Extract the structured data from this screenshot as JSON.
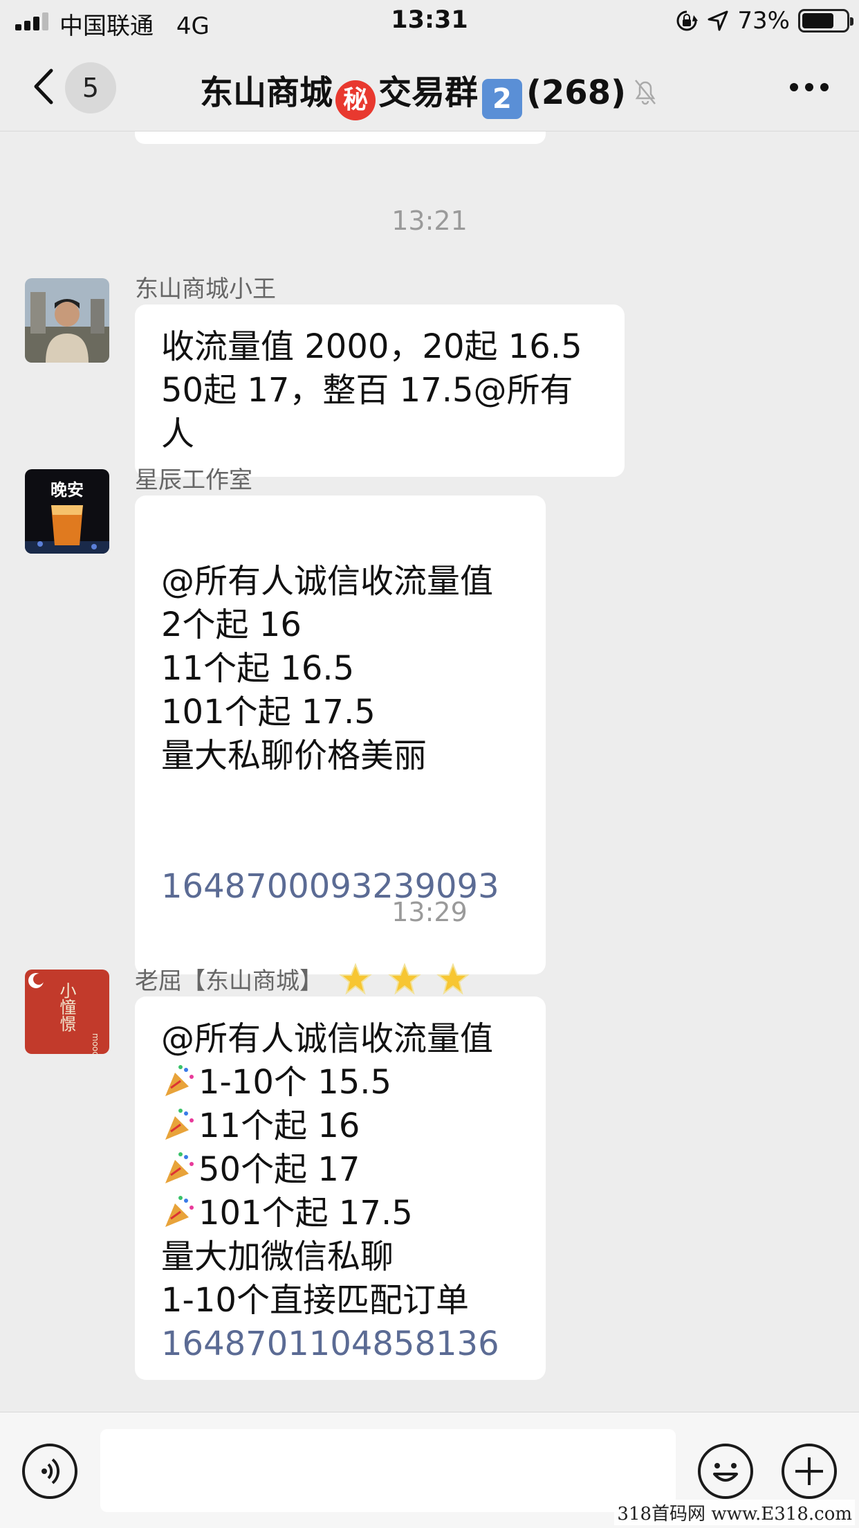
{
  "status_bar": {
    "carrier": "中国联通",
    "network": "4G",
    "time": "13:31",
    "battery": "73%",
    "battery_level": 0.73
  },
  "nav": {
    "back_badge": "5",
    "title_prefix": "东山商城",
    "title_secret": "秘",
    "title_middle": "交易群",
    "title_number": "2",
    "title_count": "(268)"
  },
  "chat": {
    "timestamps": [
      "13:21",
      "13:29"
    ],
    "messages": [
      {
        "sender": "东山商城小王",
        "text": "收流量值 2000，20起 16.5\n50起 17，整百 17.5@所有人"
      },
      {
        "sender": "星辰工作室",
        "avatar_text": "晚安",
        "text": "@所有人诚信收流量值\n2个起 16\n11个起 16.5\n101个起 17.5\n量大私聊价格美丽",
        "link": "1648700093239093"
      },
      {
        "sender": "老屈【东山商城】",
        "avatar_text": "小憧憬",
        "avatar_subtext": "mood",
        "line1": "@所有人诚信收流量值",
        "party_lines": [
          "1-10个 15.5",
          "11个起 16",
          "50个起 17",
          "101个起 17.5"
        ],
        "line_after_1": "量大加微信私聊",
        "line_after_2": "1-10个直接匹配订单",
        "link": "1648701104858136"
      }
    ]
  },
  "watermark": "318首码网 www.E318.com",
  "colors": {
    "background": "#ededed",
    "bubble": "#ffffff",
    "link": "#5b6b94",
    "timestamp": "#9a9a9a"
  },
  "icons": [
    "signal-icon",
    "lock-rotation-icon",
    "location-arrow-icon",
    "battery-icon",
    "back-arrow-icon",
    "mute-bell-icon",
    "more-icon",
    "voice-icon",
    "emoji-icon",
    "plus-icon",
    "party-popper-icon",
    "glowing-star-icon"
  ]
}
